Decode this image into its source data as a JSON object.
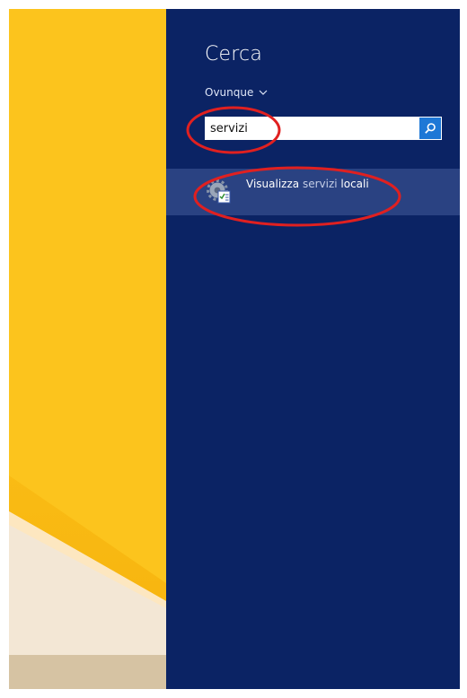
{
  "charm": {
    "title": "Cerca",
    "scope_label": "Ovunque",
    "search": {
      "value": "servizi",
      "icon": "search-icon"
    },
    "results": [
      {
        "prefix": "Visualizza ",
        "middle": "servizi ",
        "suffix": "locali",
        "icon": "services-icon"
      }
    ]
  },
  "colors": {
    "panel": "#0b2364",
    "result_highlight": "#2a4282",
    "search_button": "#1e78d6",
    "annotation": "#e02020",
    "wallpaper": "#fbbf17"
  }
}
